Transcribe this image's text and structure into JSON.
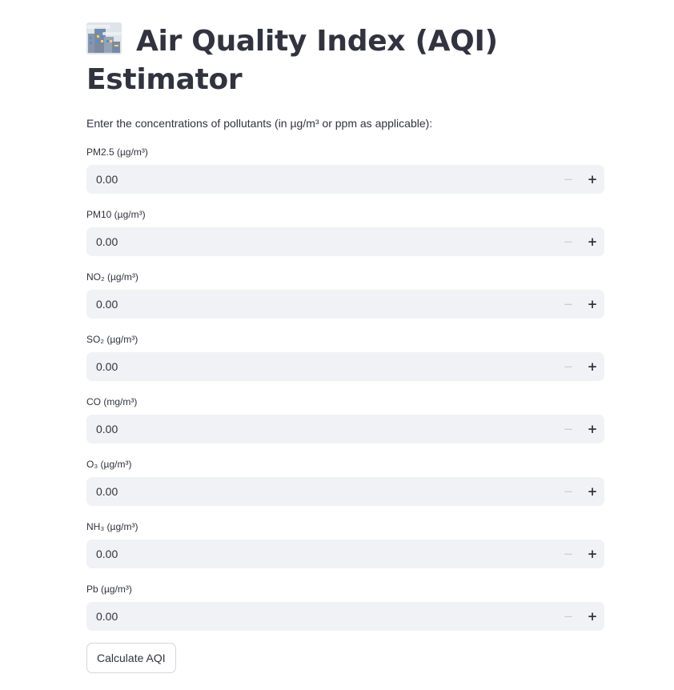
{
  "header": {
    "emoji_icon": "cityscape-fog-icon",
    "title": "Air Quality Index (AQI) Estimator"
  },
  "intro_text": "Enter the concentrations of pollutants (in µg/m³ or ppm as applicable):",
  "fields": [
    {
      "label": "PM2.5 (µg/m³)",
      "value": "0.00"
    },
    {
      "label": "PM10 (µg/m³)",
      "value": "0.00"
    },
    {
      "label": "NO₂ (µg/m³)",
      "value": "0.00"
    },
    {
      "label": "SO₂ (µg/m³)",
      "value": "0.00"
    },
    {
      "label": "CO (mg/m³)",
      "value": "0.00"
    },
    {
      "label": "O₃ (µg/m³)",
      "value": "0.00"
    },
    {
      "label": "NH₃ (µg/m³)",
      "value": "0.00"
    },
    {
      "label": "Pb (µg/m³)",
      "value": "0.00"
    }
  ],
  "stepper": {
    "minus": "−",
    "plus": "+"
  },
  "actions": {
    "calculate_label": "Calculate AQI"
  },
  "colors": {
    "text": "#31333f",
    "input_bg": "#f0f2f6",
    "minus_disabled": "#c9ccd3",
    "button_border": "#d5d7de"
  }
}
